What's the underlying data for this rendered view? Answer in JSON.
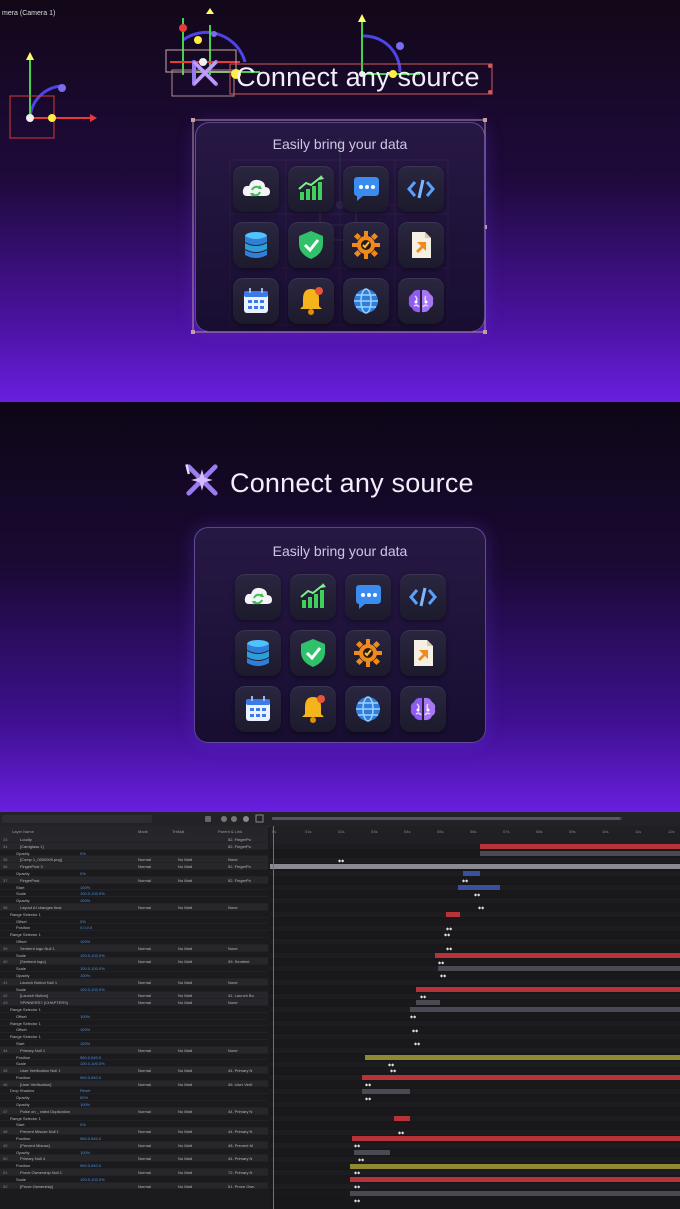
{
  "viewer": {
    "camera_label": "mera (Camera 1)"
  },
  "scene": {
    "headline": "Connect any source",
    "card_title": "Easily bring your data",
    "icons": [
      "cloud-sync-icon",
      "growth-chart-icon",
      "chat-bubble-icon",
      "code-icon",
      "database-icon",
      "shield-check-icon",
      "gear-check-icon",
      "document-arrow-icon",
      "calendar-icon",
      "bell-icon",
      "globe-icon",
      "brain-icon"
    ]
  },
  "colors": {
    "accent_purple": "#6a1ee0",
    "timeline_red": "#b8323a",
    "timeline_olive": "#8f8a32",
    "timeline_blue": "#3a4fa0",
    "timeline_gray": "#4a4a52"
  },
  "timeline": {
    "columns": [
      "Layer Name",
      "Mode",
      "TrkMat",
      "Parent & Link"
    ],
    "ruler_ticks": [
      "0s",
      "01s",
      "02s",
      "03s",
      "04s",
      "05s",
      "06s",
      "07s",
      "08s",
      "09s",
      "10s",
      "11s",
      "12s"
    ],
    "layers": [
      {
        "num": "33",
        "name": "Loudly",
        "type": "main",
        "mode": "",
        "matte": "",
        "parent": "52. FingerPo"
      },
      {
        "num": "34",
        "name": "[Cardglass 1]",
        "type": "main",
        "mode": "",
        "matte": "",
        "parent": "52. FingerPo"
      },
      {
        "num": "",
        "name": "Opacity",
        "type": "prop",
        "val": "0%"
      },
      {
        "num": "35",
        "name": "[Comp 1_0000000.png]",
        "type": "main",
        "mode": "Normal",
        "matte": "No Matt",
        "parent": "None"
      },
      {
        "num": "36",
        "name": "FingerPost 3",
        "type": "main",
        "mode": "Normal",
        "matte": "No Matt",
        "parent": "52. FingerPo"
      },
      {
        "num": "",
        "name": "Opacity",
        "type": "prop",
        "val": "0%"
      },
      {
        "num": "37",
        "name": "FingerPost",
        "type": "main",
        "mode": "Normal",
        "matte": "No Matt",
        "parent": "52. FingerPo"
      },
      {
        "num": "",
        "name": "Start",
        "type": "prop",
        "val": "100%"
      },
      {
        "num": "",
        "name": "Scale",
        "type": "prop",
        "val": "100.0,100.0%"
      },
      {
        "num": "",
        "name": "Opacity",
        "type": "prop",
        "val": "100%"
      },
      {
        "num": "38",
        "name": "Layout AI changes final",
        "type": "main",
        "mode": "Normal",
        "matte": "No Matt",
        "parent": "None"
      },
      {
        "num": "",
        "name": "Range Selector 1",
        "type": "group"
      },
      {
        "num": "",
        "name": "Offset",
        "type": "prop",
        "val": "0%"
      },
      {
        "num": "",
        "name": "Position",
        "type": "prop",
        "val": "0.0,0.0"
      },
      {
        "num": "",
        "name": "Range Selector 1",
        "type": "group"
      },
      {
        "num": "",
        "name": "Offset",
        "type": "prop",
        "val": "100%"
      },
      {
        "num": "39",
        "name": "Sentient logo Null 1",
        "type": "main",
        "mode": "Normal",
        "matte": "No Matt",
        "parent": "None"
      },
      {
        "num": "",
        "name": "Scale",
        "type": "prop",
        "val": "100.0,100.0%"
      },
      {
        "num": "40",
        "name": "[Sentient logo]",
        "type": "main",
        "mode": "Normal",
        "matte": "No Matt",
        "parent": "39. Sentient"
      },
      {
        "num": "",
        "name": "Scale",
        "type": "prop",
        "val": "100.0,100.0%"
      },
      {
        "num": "",
        "name": "Opacity",
        "type": "prop",
        "val": "100%"
      },
      {
        "num": "41",
        "name": "Launch Button Null 1",
        "type": "main",
        "mode": "Normal",
        "matte": "No Matt",
        "parent": "None"
      },
      {
        "num": "",
        "name": "Scale",
        "type": "prop",
        "val": "100.0,100.0%"
      },
      {
        "num": "42",
        "name": "[Launch Button]",
        "type": "main",
        "mode": "Normal",
        "matte": "No Matt",
        "parent": "41. Launch Bu"
      },
      {
        "num": "43",
        "name": "SPINNERS? (CHAPTERS)",
        "type": "main",
        "mode": "Normal",
        "matte": "No Matt",
        "parent": "None"
      },
      {
        "num": "",
        "name": "Range Selector 1",
        "type": "group"
      },
      {
        "num": "",
        "name": "Offset",
        "type": "prop",
        "val": "100%"
      },
      {
        "num": "",
        "name": "Range Selector 1",
        "type": "group"
      },
      {
        "num": "",
        "name": "Offset",
        "type": "prop",
        "val": "100%"
      },
      {
        "num": "",
        "name": "Range Selector 1",
        "type": "group"
      },
      {
        "num": "",
        "name": "Start",
        "type": "prop",
        "val": "100%"
      },
      {
        "num": "44",
        "name": "Primary Null 1",
        "type": "main",
        "mode": "Normal",
        "matte": "No Matt",
        "parent": "None"
      },
      {
        "num": "",
        "name": "Position",
        "type": "prop",
        "val": "960.0,540.0"
      },
      {
        "num": "",
        "name": "Scale",
        "type": "prop",
        "val": "100.0,100.0%"
      },
      {
        "num": "45",
        "name": "User Verification Null 1",
        "type": "main",
        "mode": "Normal",
        "matte": "No Matt",
        "parent": "44. Primary N"
      },
      {
        "num": "",
        "name": "Position",
        "type": "prop",
        "val": "960.0,540.0"
      },
      {
        "num": "46",
        "name": "[User Verification]",
        "type": "main",
        "mode": "Normal",
        "matte": "No Matt",
        "parent": "45. User Verif"
      },
      {
        "num": "",
        "name": "Drop Shadow",
        "type": "group",
        "val": "Reset"
      },
      {
        "num": "",
        "name": "Opacity",
        "type": "prop",
        "val": "50%"
      },
      {
        "num": "",
        "name": "Opacity",
        "type": "prop",
        "val": "100%"
      },
      {
        "num": "47",
        "name": "Pulse on _ rated Duplication",
        "type": "main",
        "mode": "Normal",
        "matte": "No Matt",
        "parent": "44. Primary N"
      },
      {
        "num": "",
        "name": "Range Selector 1",
        "type": "group"
      },
      {
        "num": "",
        "name": "Start",
        "type": "prop",
        "val": "0%"
      },
      {
        "num": "48",
        "name": "Prevent Misuse Null 1",
        "type": "main",
        "mode": "Normal",
        "matte": "No Matt",
        "parent": "44. Primary N"
      },
      {
        "num": "",
        "name": "Position",
        "type": "prop",
        "val": "960.0,540.0"
      },
      {
        "num": "49",
        "name": "[Prevent Misuse]",
        "type": "main",
        "mode": "Normal",
        "matte": "No Matt",
        "parent": "48. Prevent M"
      },
      {
        "num": "",
        "name": "Opacity",
        "type": "prop",
        "val": "100%"
      },
      {
        "num": "50",
        "name": "Primary Null 4",
        "type": "main",
        "mode": "Normal",
        "matte": "No Matt",
        "parent": "44. Primary N"
      },
      {
        "num": "",
        "name": "Position",
        "type": "prop",
        "val": "960.0,540.0"
      },
      {
        "num": "51",
        "name": "Prove Ownership Null 1",
        "type": "main",
        "mode": "Normal",
        "matte": "No Matt",
        "parent": "72. Primary N"
      },
      {
        "num": "",
        "name": "Scale",
        "type": "prop",
        "val": "100.0,100.0%"
      },
      {
        "num": "52",
        "name": "[Prove Ownership]",
        "type": "main",
        "mode": "Normal",
        "matte": "No Matt",
        "parent": "51. Prove Own"
      }
    ]
  }
}
